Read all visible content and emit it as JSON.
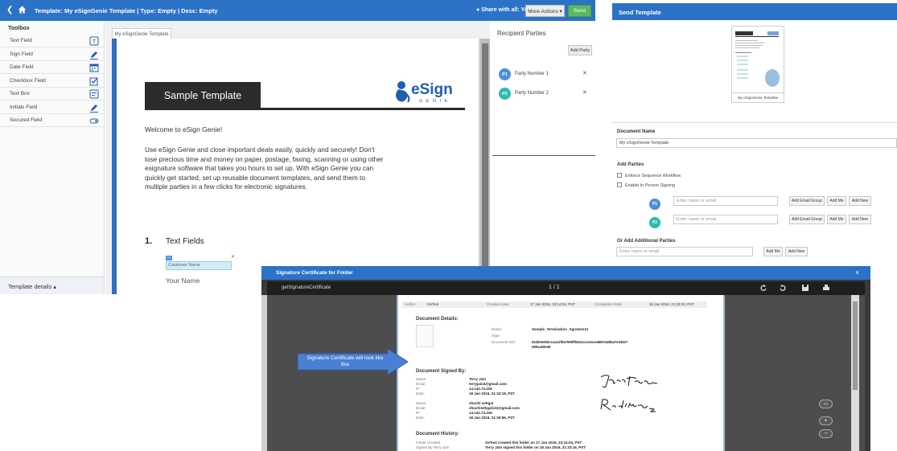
{
  "editor": {
    "header": {
      "title": "Template: My eSignGenie Template | Type: Empty | Desc: Empty",
      "share": "Share with all: Yes",
      "more_actions": "More Actions ▾",
      "send": "Send"
    },
    "toolbox": {
      "title": "Toolbox",
      "items": [
        {
          "label": "Text Field",
          "icon": "text-field-icon"
        },
        {
          "label": "Sign Field",
          "icon": "pen-icon"
        },
        {
          "label": "Date Field",
          "icon": "calendar-icon"
        },
        {
          "label": "Checkbox Field",
          "icon": "checkbox-icon"
        },
        {
          "label": "Text Box",
          "icon": "textbox-icon"
        },
        {
          "label": "Initials Field",
          "icon": "pen-icon"
        },
        {
          "label": "Secured Field",
          "icon": "secured-icon"
        }
      ],
      "template_details": "Template details ▴"
    },
    "document": {
      "tab": "My eSignGenie Template",
      "banner": "Sample Template",
      "logo_text": "eSign",
      "logo_sub": "G E N I E",
      "welcome": "Welcome to eSign Genie!",
      "paragraph": "Use eSign Genie and close important deals easily, quickly and securely! Don't lose precious time and money on paper, postage, faxing, scanning or using other esignature software that takes you hours to set up. With eSign Genie you can quickly get started, set up reusable document templates, and send them to multiple parties in a few clicks for electronic signatures.",
      "section_num": "1.",
      "section_title": "Text Fields",
      "field_tag": "P1",
      "field_placeholder": "Customer Name",
      "your_name": "Your Name"
    },
    "recipients": {
      "title": "Recipient Parties",
      "add_party": "Add Party",
      "parties": [
        {
          "badge": "P1",
          "name": "Party Number 1",
          "color": "#4a90d9"
        },
        {
          "badge": "P2",
          "name": "Party Number 2",
          "color": "#2bbbad"
        }
      ]
    }
  },
  "send_template": {
    "title": "Send Template",
    "thumb_caption": "My eSignGenie Template",
    "doc_name_label": "Document Name",
    "doc_name_value": "My eSignGenie Template",
    "add_parties_label": "Add Parties",
    "enforce_sequence": "Enforce Sequence Workflow",
    "in_person": "Enable In Person Signing",
    "email_placeholder": "Enter name or email",
    "add_email_group": "Add Email Group",
    "add_me": "Add Me",
    "add_new": "Add New",
    "additional_label": "Or Add Additional Parties",
    "parties": [
      {
        "badge": "P1",
        "color": "#4a90d9"
      },
      {
        "badge": "P2",
        "color": "#2bbbad"
      }
    ]
  },
  "certificate": {
    "title": "Signature Certificate for Folder",
    "close": "×",
    "file_name": "getSignatureCertificate",
    "page_indicator": "1 / 1",
    "summary": {
      "author_label": "Author",
      "author": "GeTest",
      "created_label": "Creation Date",
      "created": "17 Jan 2016, 23:14:04, PST",
      "completed_label": "Completion Date",
      "completed": "18 Jan 2016, 21:33:22, PST"
    },
    "details_heading": "Document Details:",
    "name_label": "Name:",
    "name_value": "Sample_Termination_Agreement",
    "type_label": "Type:",
    "ref_label": "Document Ref:",
    "ref_value": "523b0e0b5ccaa21fb67990ff9431c1ce4cea8657a8b8a7e33527",
    "ref_value2": "0891a00048",
    "signed_heading": "Document Signed By:",
    "signers": [
      {
        "name": "Terry Jain",
        "email": "terryjain4@gmail.com",
        "ip": "14.142.74.226",
        "date": "18 Jan 2016, 21:33:18, PST"
      },
      {
        "name": "shuchi sehgal",
        "email": "shuchisehgal133@gmail.com",
        "ip": "14.142.74.226",
        "date": "18 Jan 2016, 21:30:56, PST"
      }
    ],
    "row_labels": {
      "name": "Name:",
      "email": "Email:",
      "ip": "IP:",
      "date": "Date:"
    },
    "signatures": [
      "Terry Jain",
      "Redkhan"
    ],
    "history_heading": "Document History:",
    "history": [
      {
        "label": "Folder Created",
        "value": "GeTest  created this folder on 17 Jan 2016, 23:14:04, PST"
      },
      {
        "label": "Signed By Terry  Jain",
        "value": "Terry  Jain signed this folder on 18 Jan 2016, 21:33:16, PST"
      }
    ],
    "callout": "Signature Certificate will look like this",
    "zoom_in": "+",
    "zoom_out": "−"
  }
}
